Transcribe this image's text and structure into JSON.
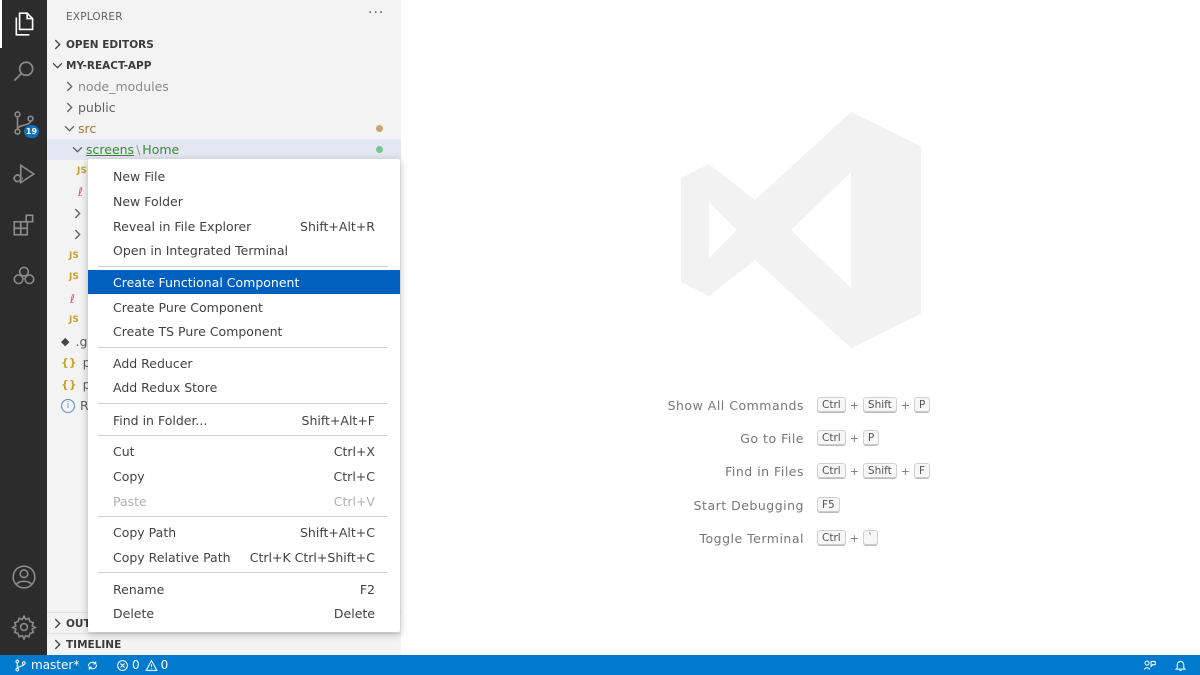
{
  "sidebar": {
    "title": "EXPLORER",
    "more": "···",
    "open_editors": "OPEN EDITORS",
    "project": "MY-REACT-APP",
    "outline": "OUTLINE",
    "timeline": "TIMELINE",
    "tree": {
      "node_modules": "node_modules",
      "public": "public",
      "src": "src",
      "screens": "screens",
      "path_sep": "\\",
      "home": "Home",
      "partial_g": ".g",
      "partial_p1": "p",
      "partial_p2": "p",
      "partial_r": "R"
    }
  },
  "activity": {
    "source_control_badge": "19"
  },
  "context_menu": {
    "items": [
      {
        "label": "New File",
        "key": ""
      },
      {
        "label": "New Folder",
        "key": ""
      },
      {
        "label": "Reveal in File Explorer",
        "key": "Shift+Alt+R"
      },
      {
        "label": "Open in Integrated Terminal",
        "key": ""
      },
      {
        "label": "Create Functional Component",
        "key": ""
      },
      {
        "label": "Create Pure Component",
        "key": ""
      },
      {
        "label": "Create TS Pure Component",
        "key": ""
      },
      {
        "label": "Add Reducer",
        "key": ""
      },
      {
        "label": "Add Redux Store",
        "key": ""
      },
      {
        "label": "Find in Folder...",
        "key": "Shift+Alt+F"
      },
      {
        "label": "Cut",
        "key": "Ctrl+X"
      },
      {
        "label": "Copy",
        "key": "Ctrl+C"
      },
      {
        "label": "Paste",
        "key": "Ctrl+V"
      },
      {
        "label": "Copy Path",
        "key": "Shift+Alt+C"
      },
      {
        "label": "Copy Relative Path",
        "key": "Ctrl+K Ctrl+Shift+C"
      },
      {
        "label": "Rename",
        "key": "F2"
      },
      {
        "label": "Delete",
        "key": "Delete"
      }
    ]
  },
  "welcome": {
    "hints": [
      {
        "label": "Show All Commands",
        "keys": [
          "Ctrl",
          "Shift",
          "P"
        ]
      },
      {
        "label": "Go to File",
        "keys": [
          "Ctrl",
          "P"
        ]
      },
      {
        "label": "Find in Files",
        "keys": [
          "Ctrl",
          "Shift",
          "F"
        ]
      },
      {
        "label": "Start Debugging",
        "keys": [
          "F5"
        ]
      },
      {
        "label": "Toggle Terminal",
        "keys": [
          "Ctrl",
          "`"
        ]
      }
    ],
    "plus": "+"
  },
  "statusbar": {
    "branch": "master*",
    "errors": "0",
    "warnings": "0"
  },
  "colors": {
    "accent": "#007acc",
    "menu_highlight": "#0060c0",
    "activity_bg": "#2c2c2c",
    "sidebar_bg": "#f3f3f3",
    "modified_dot": "#c5a56d",
    "untracked_dot": "#73c991"
  },
  "icons": {
    "activity": [
      "explorer-icon",
      "search-icon",
      "source-control-icon",
      "run-debug-icon",
      "extensions-icon",
      "remote-explorer-icon",
      "account-icon",
      "settings-gear-icon"
    ],
    "status": [
      "git-branch-icon",
      "sync-icon",
      "error-icon",
      "warning-icon",
      "feedback-icon",
      "bell-icon"
    ]
  }
}
